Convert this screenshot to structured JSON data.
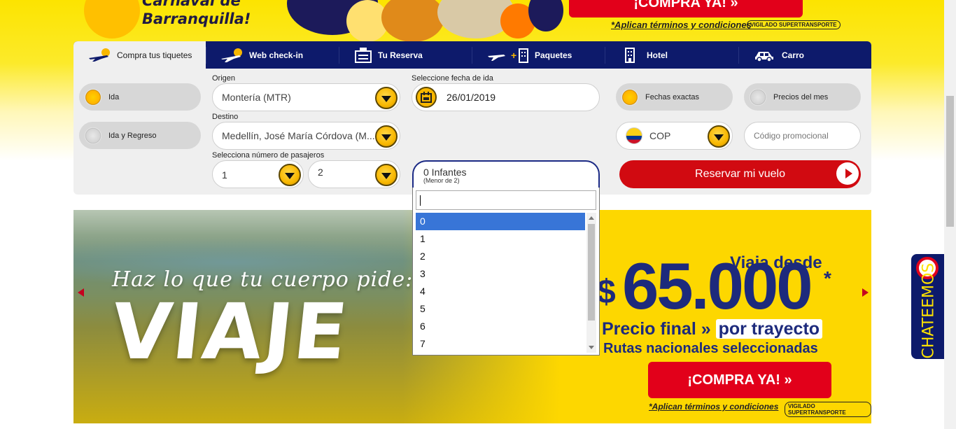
{
  "top_banner": {
    "headline_line1": "Carnaval de",
    "headline_line2": "Barranquilla!",
    "buy_button": "¡COMPRA YA! »",
    "terms": "*Aplican términos y condiciones",
    "vigilado": "VIGILADO SUPERTRANSPORTE"
  },
  "tabs": [
    {
      "label": "Compra tus tiquetes",
      "icon": "plane-icon",
      "active": true
    },
    {
      "label": "Web check-in",
      "icon": "checkin-plane-icon",
      "active": false
    },
    {
      "label": "Tu Reserva",
      "icon": "reservation-icon",
      "active": false
    },
    {
      "label": "Paquetes",
      "icon": "plane-hotel-icon",
      "active": false
    },
    {
      "label": "Hotel",
      "icon": "hotel-building-icon",
      "active": false
    },
    {
      "label": "Carro",
      "icon": "car-icon",
      "active": false
    }
  ],
  "trip_type": {
    "one_way": "Ida",
    "round_trip": "Ida y Regreso",
    "selected": "Ida"
  },
  "origin": {
    "label": "Origen",
    "value": "Montería (MTR)"
  },
  "destination": {
    "label": "Destino",
    "value": "Medellín, José María Córdova (M..."
  },
  "departure": {
    "label": "Seleccione fecha de ida",
    "value": "26/01/2019",
    "icon": "calendar-icon"
  },
  "date_mode": {
    "exact": "Fechas exactas",
    "month": "Precios del mes",
    "selected": "Fechas exactas"
  },
  "currency": {
    "value": "COP",
    "flag": "colombia-flag-icon"
  },
  "promo": {
    "placeholder": "Código promocional"
  },
  "passengers": {
    "label": "Selecciona número de pasajeros",
    "adults": "1",
    "children": "2",
    "infants": "0 Infantes",
    "infants_note": "(Menor de 2)"
  },
  "submit": {
    "label": "Reservar mi vuelo"
  },
  "infants_dropdown": {
    "search_value": "",
    "options": [
      "0",
      "1",
      "2",
      "3",
      "4",
      "5",
      "6",
      "7"
    ],
    "selected": "0"
  },
  "hero": {
    "slogan": "Haz lo que tu cuerpo pide:",
    "big_word": "VIAJE",
    "from": "Viaja desde",
    "currency": "$",
    "price": "65.000",
    "star": "*",
    "line1_a": "Precio final » ",
    "line1_b": "por trayecto",
    "line2": "Rutas nacionales seleccionadas",
    "button": "¡COMPRA YA! »",
    "terms": "*Aplican términos y condiciones",
    "vigilado": "VIGILADO SUPERTRANSPORTE"
  },
  "chat": {
    "label": "CHATEEMOS"
  },
  "colors": {
    "navy": "#0d1a6b",
    "yellow": "#fdd700",
    "red": "#d10a11",
    "orange": "#f8b700"
  }
}
